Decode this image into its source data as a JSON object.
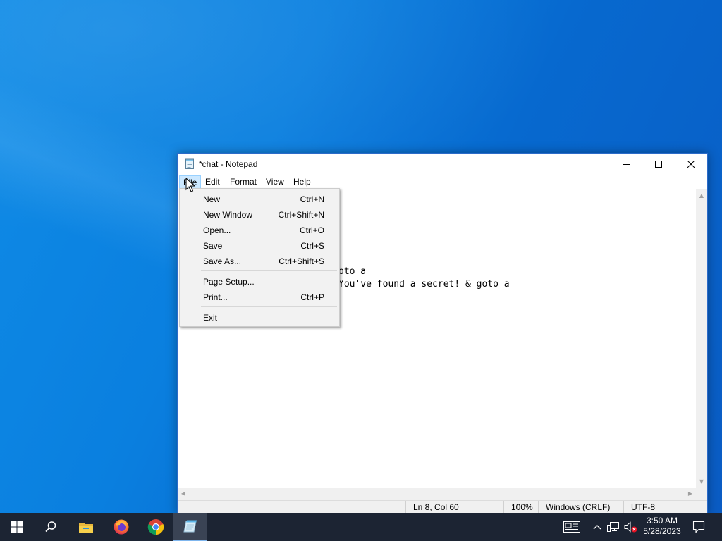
{
  "window": {
    "title": "*chat - Notepad"
  },
  "menubar": {
    "items": [
      "File",
      "Edit",
      "Format",
      "View",
      "Help"
    ]
  },
  "editor": {
    "visible_lines": [
      "oto a",
      "You've found a secret! & goto a"
    ]
  },
  "file_menu": {
    "items": [
      {
        "label": "New",
        "shortcut": "Ctrl+N"
      },
      {
        "label": "New Window",
        "shortcut": "Ctrl+Shift+N"
      },
      {
        "label": "Open...",
        "shortcut": "Ctrl+O"
      },
      {
        "label": "Save",
        "shortcut": "Ctrl+S"
      },
      {
        "label": "Save As...",
        "shortcut": "Ctrl+Shift+S"
      },
      {
        "label": "Page Setup...",
        "shortcut": ""
      },
      {
        "label": "Print...",
        "shortcut": "Ctrl+P"
      },
      {
        "label": "Exit",
        "shortcut": ""
      }
    ]
  },
  "statusbar": {
    "position": "Ln 8, Col 60",
    "zoom": "100%",
    "line_ending": "Windows (CRLF)",
    "encoding": "UTF-8"
  },
  "taskbar": {
    "apps": [
      "start-icon",
      "search-icon",
      "file-explorer-icon",
      "firefox-icon",
      "chrome-icon",
      "notepad-icon"
    ],
    "active_app": "notepad-icon",
    "time": "3:50 AM",
    "date": "5/28/2023"
  },
  "colors": {
    "desktop_accent": "#0a78d7",
    "taskbar": "#1c2433",
    "menu_highlight": "#cce8ff",
    "window_border": "#2b6bc9"
  }
}
